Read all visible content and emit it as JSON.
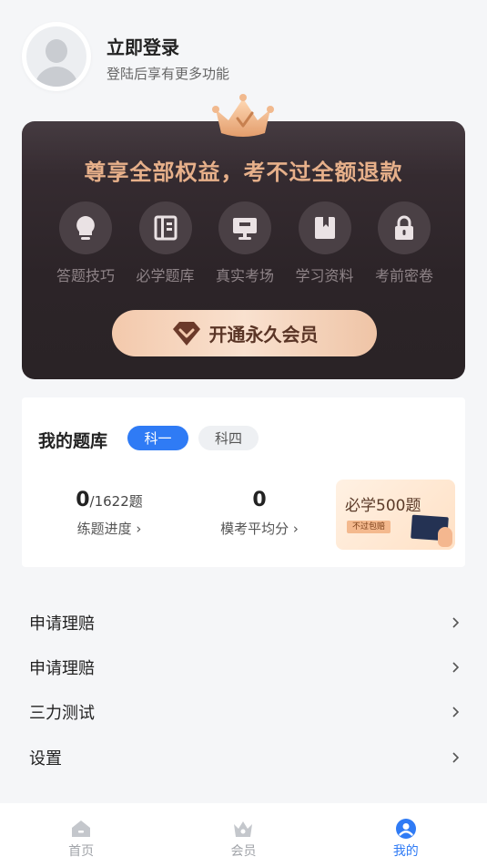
{
  "header": {
    "login_title": "立即登录",
    "login_subtitle": "登陆后享有更多功能"
  },
  "vip": {
    "title": "尊享全部权益，考不过全额退款",
    "benefits": [
      {
        "label": "答题技巧",
        "icon": "lightbulb-icon"
      },
      {
        "label": "必学题库",
        "icon": "question-bank-icon"
      },
      {
        "label": "真实考场",
        "icon": "exam-screen-icon"
      },
      {
        "label": "学习资料",
        "icon": "book-icon"
      },
      {
        "label": "考前密卷",
        "icon": "lock-icon"
      }
    ],
    "button_label": "开通永久会员",
    "accent": "#e7b08a"
  },
  "question_bank": {
    "title": "我的题库",
    "tabs": [
      "科一",
      "科四"
    ],
    "active_tab": "科一",
    "progress_done": "0",
    "progress_total": "/1622题",
    "progress_label": "练题进度",
    "avg_score": "0",
    "avg_score_label": "模考平均分",
    "promo_title": "必学500题",
    "promo_tag": "不过包赔"
  },
  "menu": [
    {
      "label": "申请理赔"
    },
    {
      "label": "申请理赔"
    },
    {
      "label": "三力测试"
    },
    {
      "label": "设置"
    }
  ],
  "tabbar": [
    {
      "label": "首页",
      "icon": "home-icon",
      "active": false
    },
    {
      "label": "会员",
      "icon": "vip-crown-icon",
      "active": false
    },
    {
      "label": "我的",
      "icon": "user-icon",
      "active": true
    }
  ],
  "colors": {
    "primary_blue": "#2f7bf5",
    "card_dark": "#2c2428",
    "gold_button": "#f3c9ac"
  }
}
